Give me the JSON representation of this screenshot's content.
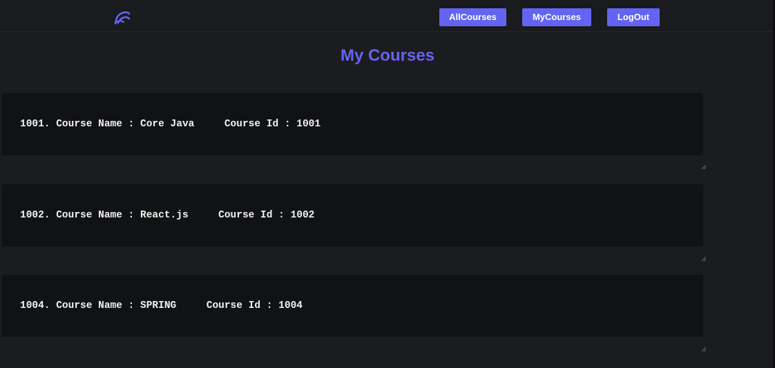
{
  "navbar": {
    "logo_icon": "app-logo-icon",
    "buttons": [
      {
        "label": "AllCourses"
      },
      {
        "label": "MyCourses"
      },
      {
        "label": "LogOut"
      }
    ]
  },
  "page": {
    "title": "My Courses"
  },
  "courses": [
    {
      "text": "1001. Course Name : Core Java     Course Id : 1001"
    },
    {
      "text": "1002. Course Name : React.js     Course Id : 1002"
    },
    {
      "text": "1004. Course Name : SPRING     Course Id : 1004"
    }
  ],
  "colors": {
    "accent": "#6464f2",
    "background": "#1b1c1f",
    "card": "#111214",
    "text": "#f2f2f2"
  }
}
